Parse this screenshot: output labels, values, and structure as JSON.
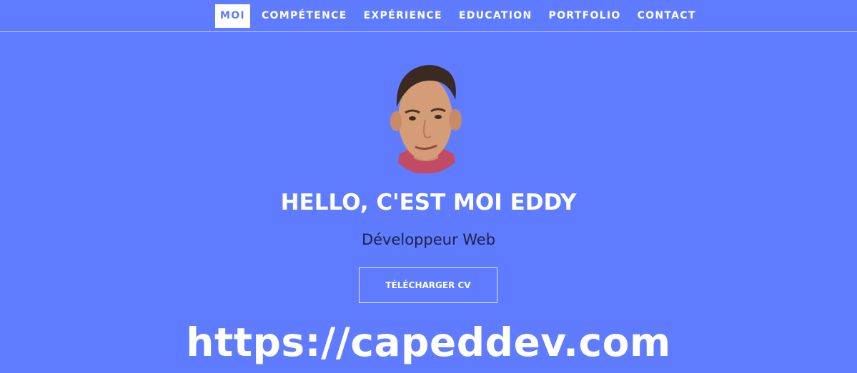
{
  "nav": {
    "items": [
      {
        "label": "MOI",
        "active": true
      },
      {
        "label": "COMPÉTENCE",
        "active": false
      },
      {
        "label": "EXPÉRIENCE",
        "active": false
      },
      {
        "label": "EDUCATION",
        "active": false
      },
      {
        "label": "PORTFOLIO",
        "active": false
      },
      {
        "label": "CONTACT",
        "active": false
      }
    ]
  },
  "hero": {
    "avatar_icon": "profile-photo",
    "title": "HELLO, C'EST MOI EDDY",
    "subtitle": "Développeur Web",
    "cv_button_label": "TÉLÉCHARGER CV"
  },
  "watermark": {
    "url_text": "https://capeddev.com"
  },
  "colors": {
    "background": "#5f7bff",
    "text_primary": "#ffffff",
    "subtitle_text": "#1b2240"
  }
}
